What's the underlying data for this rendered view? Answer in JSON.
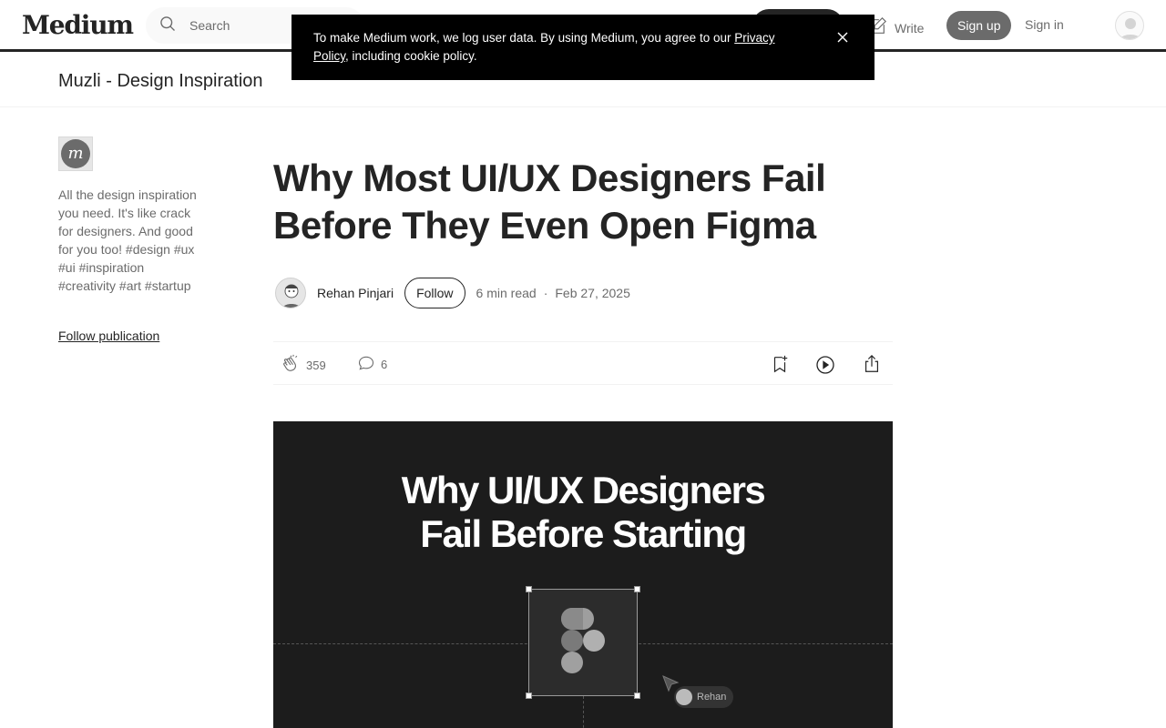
{
  "header": {
    "logo": "Medium",
    "search_placeholder": "Search",
    "write_label": "Write",
    "signup_label": "Sign up",
    "signin_label": "Sign in"
  },
  "cookie_banner": {
    "text_before": "To make Medium work, we log user data. By using Medium, you agree to our ",
    "link_text": "Privacy Policy",
    "text_after": ", including cookie policy."
  },
  "publication": {
    "name": "Muzli - Design Inspiration",
    "logo_letter": "m",
    "description": "All the design inspiration you need. It's like crack for designers. And good for you too! #design #ux #ui #inspiration #creativity #art #startup",
    "follow_label": "Follow publication"
  },
  "article": {
    "title": "Why Most UI/UX Designers Fail Before They Even Open Figma",
    "author": "Rehan Pinjari",
    "follow_label": "Follow",
    "read_time": "6 min read",
    "date": "Feb 27, 2025",
    "claps": "359",
    "responses": "6"
  },
  "hero": {
    "title_line1": "Why UI/UX Designers",
    "title_line2": "Fail Before Starting",
    "cursor_tag": "Rehan"
  }
}
